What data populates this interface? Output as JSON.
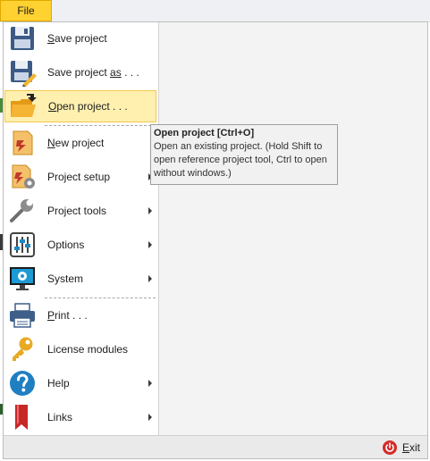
{
  "file_tab": {
    "label": "File"
  },
  "menu": {
    "items": [
      {
        "prefix": "",
        "underline": "S",
        "suffix": "ave project",
        "has_submenu": false,
        "icon": "floppy-disk-icon"
      },
      {
        "prefix": "Save project ",
        "underline": "as",
        "suffix": " . . .",
        "has_submenu": false,
        "icon": "save-as-icon"
      },
      {
        "prefix": "",
        "underline": "O",
        "suffix": "pen project . . .",
        "has_submenu": false,
        "icon": "open-folder-icon",
        "active": true
      },
      {
        "prefix": "",
        "underline": "N",
        "suffix": "ew project",
        "has_submenu": false,
        "icon": "new-project-icon"
      },
      {
        "prefix": "",
        "underline": "",
        "suffix": "Project setup",
        "has_submenu": true,
        "icon": "project-setup-icon"
      },
      {
        "prefix": "",
        "underline": "",
        "suffix": "Project tools",
        "has_submenu": true,
        "icon": "wrench-icon"
      },
      {
        "prefix": "",
        "underline": "",
        "suffix": "Options",
        "has_submenu": true,
        "icon": "sliders-icon"
      },
      {
        "prefix": "",
        "underline": "",
        "suffix": "System",
        "has_submenu": true,
        "icon": "system-monitor-icon"
      },
      {
        "prefix": "",
        "underline": "P",
        "suffix": "rint . . .",
        "has_submenu": false,
        "icon": "printer-icon"
      },
      {
        "prefix": "",
        "underline": "",
        "suffix": "License modules",
        "has_submenu": false,
        "icon": "key-icon"
      },
      {
        "prefix": "",
        "underline": "",
        "suffix": "Help",
        "has_submenu": true,
        "icon": "help-icon"
      },
      {
        "prefix": "",
        "underline": "",
        "suffix": "Links",
        "has_submenu": true,
        "icon": "bookmark-icon"
      }
    ]
  },
  "tooltip": {
    "title": "Open project [Ctrl+O]",
    "body": "Open an existing project. (Hold Shift to open reference project tool, Ctrl to open without windows.)"
  },
  "footer": {
    "exit_underline": "E",
    "exit_suffix": "xit",
    "icon": "power-icon"
  },
  "colors": {
    "file_tab": "#ffd231",
    "active_item": "#fff0b0",
    "active_border": "#f3c74b",
    "exit_icon": "#d42b2b"
  }
}
